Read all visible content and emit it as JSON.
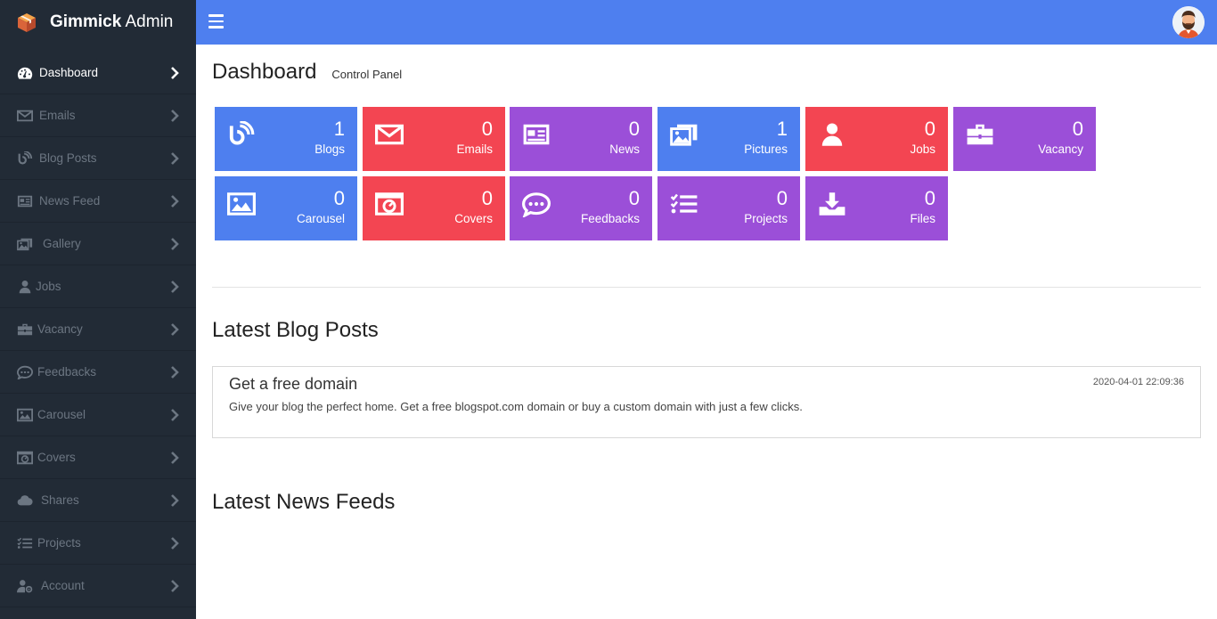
{
  "brand": {
    "name_bold": "Gimmick",
    "name_rest": " Admin"
  },
  "sidebar": {
    "items": [
      {
        "label": "Dashboard",
        "icon": "tachometer-icon",
        "active": true
      },
      {
        "label": "Emails",
        "icon": "envelope-icon"
      },
      {
        "label": "Blog Posts",
        "icon": "blog-icon"
      },
      {
        "label": "News Feed",
        "icon": "newspaper-icon"
      },
      {
        "label": "Gallery",
        "icon": "images-icon"
      },
      {
        "label": "Jobs",
        "icon": "user-tie-icon"
      },
      {
        "label": "Vacancy",
        "icon": "briefcase-icon"
      },
      {
        "label": "Feedbacks",
        "icon": "comment-dots-icon"
      },
      {
        "label": "Carousel",
        "icon": "image-icon"
      },
      {
        "label": "Covers",
        "icon": "cover-icon"
      },
      {
        "label": "Shares",
        "icon": "cloud-icon"
      },
      {
        "label": "Projects",
        "icon": "tasks-icon"
      },
      {
        "label": "Account",
        "icon": "user-cog-icon"
      }
    ]
  },
  "header": {
    "title": "Dashboard",
    "subtitle": "Control Panel"
  },
  "tiles": [
    {
      "value": "1",
      "label": "Blogs",
      "color": "#4e7fef",
      "icon": "blog-icon"
    },
    {
      "value": "0",
      "label": "Emails",
      "color": "#f34552",
      "icon": "envelope-icon"
    },
    {
      "value": "0",
      "label": "News",
      "color": "#9b4fd8",
      "icon": "newspaper-icon"
    },
    {
      "value": "1",
      "label": "Pictures",
      "color": "#4e7fef",
      "icon": "images-icon"
    },
    {
      "value": "0",
      "label": "Jobs",
      "color": "#f34552",
      "icon": "user-tie-icon"
    },
    {
      "value": "0",
      "label": "Vacancy",
      "color": "#9b4fd8",
      "icon": "briefcase-icon"
    },
    {
      "value": "0",
      "label": "Carousel",
      "color": "#4e7fef",
      "icon": "image-icon"
    },
    {
      "value": "0",
      "label": "Covers",
      "color": "#f34552",
      "icon": "cover-icon"
    },
    {
      "value": "0",
      "label": "Feedbacks",
      "color": "#9b4fd8",
      "icon": "comment-dots-icon"
    },
    {
      "value": "0",
      "label": "Projects",
      "color": "#9b4fd8",
      "icon": "tasks-icon"
    },
    {
      "value": "0",
      "label": "Files",
      "color": "#9b4fd8",
      "icon": "download-icon"
    }
  ],
  "blog_section": {
    "title": "Latest Blog Posts",
    "posts": [
      {
        "title": "Get a free domain",
        "timestamp": "2020-04-01 22:09:36",
        "text": "Give your blog the perfect home. Get a free blogspot.com domain or buy a custom domain with just a few clicks."
      }
    ]
  },
  "news_section": {
    "title": "Latest News Feeds"
  },
  "colors": {
    "sidebar": "#222b36",
    "topbar": "#4e7fef",
    "blue": "#4e7fef",
    "red": "#f34552",
    "purple": "#9b4fd8"
  }
}
